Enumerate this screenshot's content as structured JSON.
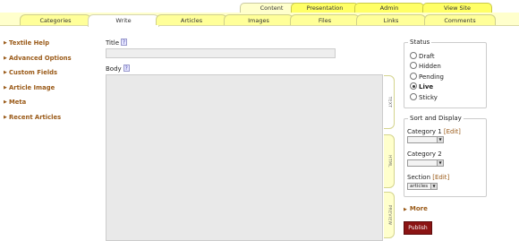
{
  "top_tabs": [
    {
      "label": "Content",
      "active": true
    },
    {
      "label": "Presentation",
      "active": false
    },
    {
      "label": "Admin",
      "active": false
    },
    {
      "label": "View Site",
      "active": false
    }
  ],
  "sub_tabs": [
    {
      "label": "Categories",
      "active": false
    },
    {
      "label": "Write",
      "active": true
    },
    {
      "label": "Articles",
      "active": false
    },
    {
      "label": "Images",
      "active": false
    },
    {
      "label": "Files",
      "active": false
    },
    {
      "label": "Links",
      "active": false
    },
    {
      "label": "Comments",
      "active": false
    }
  ],
  "sidebar": {
    "items": [
      {
        "label": "Textile Help"
      },
      {
        "label": "Advanced Options"
      },
      {
        "label": "Custom Fields"
      },
      {
        "label": "Article Image"
      },
      {
        "label": "Meta"
      },
      {
        "label": "Recent Articles"
      }
    ]
  },
  "editor": {
    "title_label": "Title",
    "title_value": "",
    "body_label": "Body",
    "body_value": "",
    "help_mark": "?",
    "view_tabs": [
      "TEXT",
      "HTML",
      "PREVIEW"
    ]
  },
  "status": {
    "legend": "Status",
    "options": [
      "Draft",
      "Hidden",
      "Pending",
      "Live",
      "Sticky"
    ],
    "selected": "Live"
  },
  "sort_display": {
    "legend": "Sort and Display",
    "category1_label": "Category 1",
    "category2_label": "Category 2",
    "section_label": "Section",
    "edit_label": "[Edit]",
    "category1_value": "",
    "category2_value": "",
    "section_value": "articles"
  },
  "more_label": "More",
  "publish_label": "Publish",
  "colors": {
    "accent_link": "#9a5a18",
    "tab_yellow": "#ffff66",
    "subbar_yellow": "#ffffcc",
    "publish_red": "#8b1414"
  }
}
